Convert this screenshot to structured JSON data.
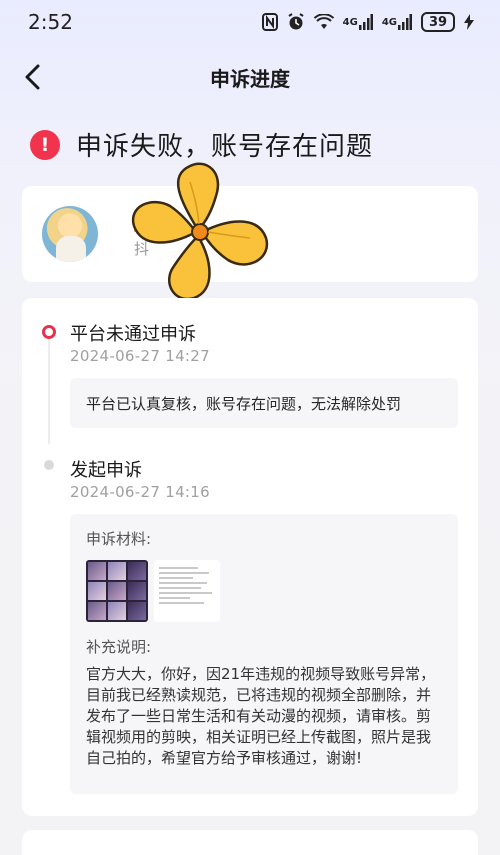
{
  "status_bar": {
    "time": "2:52",
    "signal1": "4G",
    "signal2": "4G",
    "battery": "39"
  },
  "nav": {
    "title": "申诉进度",
    "back_icon": "chevron-left-icon"
  },
  "result": {
    "icon": "alert-icon",
    "icon_glyph": "!",
    "text": "申诉失败，账号存在问题",
    "color": "#f2334d"
  },
  "account": {
    "emoji": "🌈",
    "sub": "抖"
  },
  "timeline": {
    "steps": [
      {
        "title": "平台未通过申诉",
        "time": "2024-06-27 14:27",
        "note": "平台已认真复核，账号存在问题，无法解除处罚"
      },
      {
        "title": "发起申诉",
        "time": "2024-06-27 14:16",
        "materials_label": "申诉材料:",
        "supplement_label": "补充说明:",
        "supplement_text": "官方大大，你好，因21年违规的视频导致账号异常，目前我已经熟读规范，已将违规的视频全部删除，并发布了一些日常生活和有关动漫的视频，请审核。剪辑视频用的剪映，相关证明已经上传截图，照片是我自己拍的，希望官方给予审核通过，谢谢!"
      }
    ]
  }
}
